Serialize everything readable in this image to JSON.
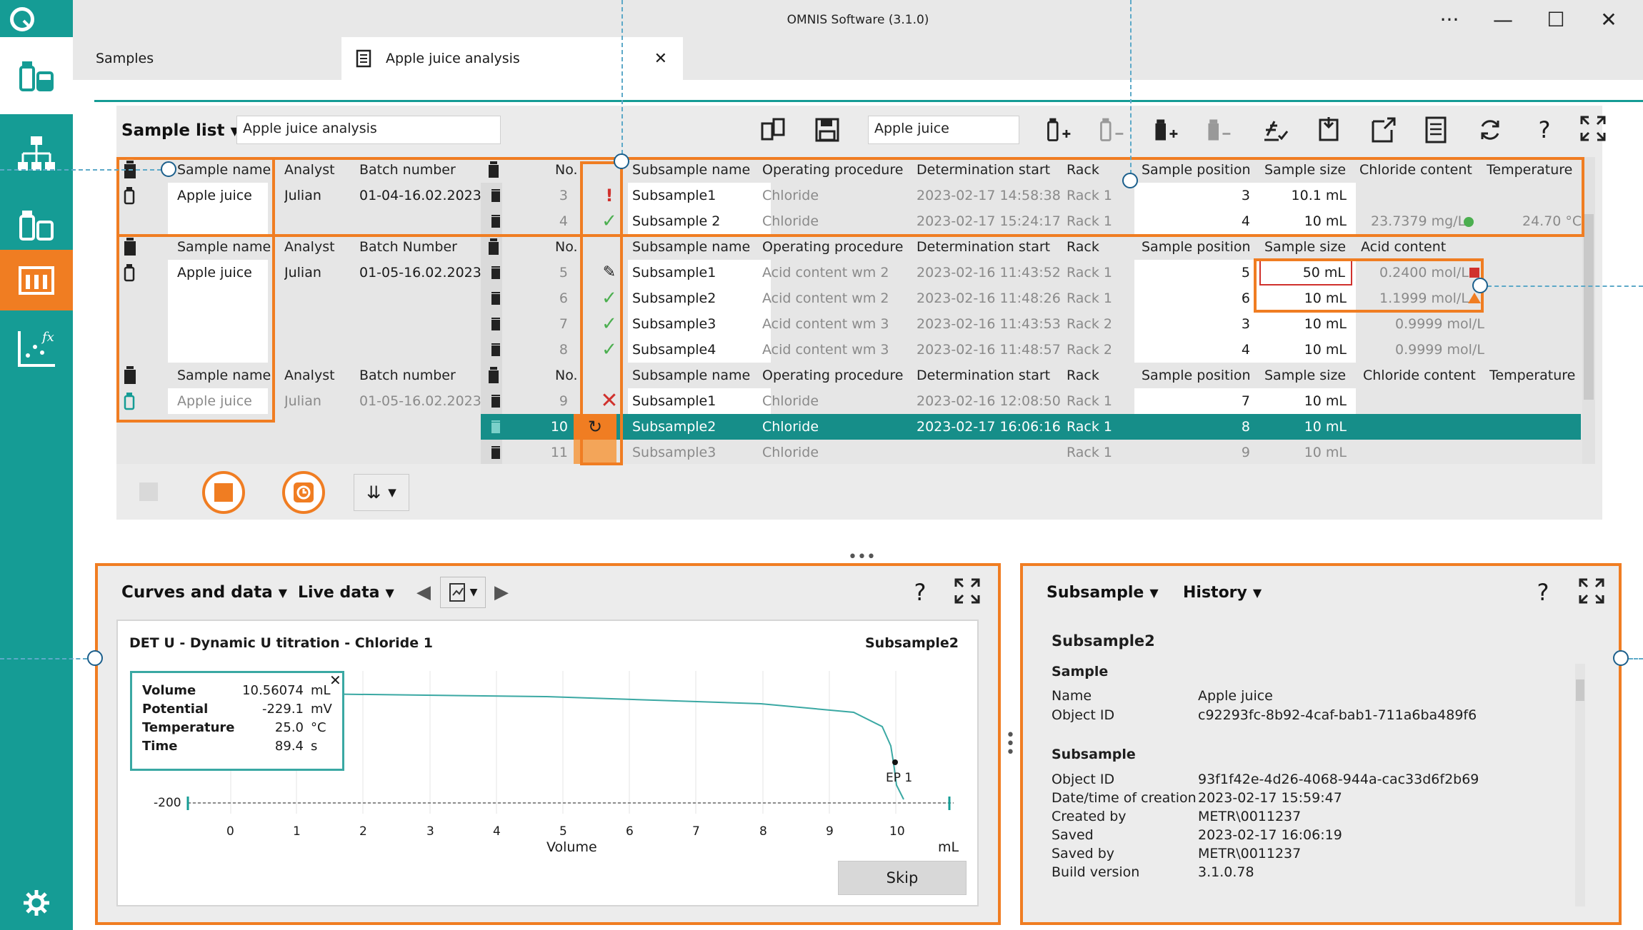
{
  "window": {
    "title": "OMNIS Software (3.1.0)"
  },
  "tabs": [
    {
      "label": "Samples"
    },
    {
      "label": "Apple juice analysis"
    }
  ],
  "sample_list": {
    "menu_label": "Sample list",
    "name_value": "Apple juice analysis",
    "filter_value": "Apple juice",
    "columns": [
      "Sample name",
      "Analyst",
      "Batch number",
      "No.",
      "Subsample name",
      "Operating procedure",
      "Determination start",
      "Rack",
      "Sample position",
      "Sample size",
      "Chloride content",
      "Temperature"
    ],
    "group2_columns": [
      "Sample name",
      "Analyst",
      "Batch Number",
      "No.",
      "Subsample name",
      "Operating procedure",
      "Determination start",
      "Rack",
      "Sample position",
      "Sample size",
      "Acid content"
    ],
    "group3_columns": [
      "Sample name",
      "Analyst",
      "Batch number",
      "No.",
      "Subsample name",
      "Operating procedure",
      "Determination start",
      "Rack",
      "Sample position",
      "Sample size",
      "Chloride content",
      "Temperature"
    ],
    "group1": {
      "sample_name": "Apple juice",
      "analyst": "Julian",
      "batch": "01-04-16.02.2023",
      "rows": [
        {
          "no": "3",
          "subsample": "Subsample1",
          "procedure": "Chloride",
          "start": "2023-02-17 14:58:38",
          "rack": "Rack 1",
          "position": "3",
          "size": "10.1 mL",
          "result": "",
          "temp": ""
        },
        {
          "no": "4",
          "subsample": "Subsample 2",
          "procedure": "Chloride",
          "start": "2023-02-17 15:24:17",
          "rack": "Rack 1",
          "position": "4",
          "size": "10 mL",
          "result": "23.7379 mg/L",
          "temp": "24.70 °C"
        }
      ]
    },
    "group2": {
      "sample_name": "Apple juice",
      "analyst": "Julian",
      "batch": "01-05-16.02.2023",
      "rows": [
        {
          "no": "5",
          "subsample": "Subsample1",
          "procedure": "Acid content wm 2",
          "start": "2023-02-16 11:43:52",
          "rack": "Rack 1",
          "position": "5",
          "size": "50 mL",
          "result": "0.2400 mol/L"
        },
        {
          "no": "6",
          "subsample": "Subsample2",
          "procedure": "Acid content wm 2",
          "start": "2023-02-16 11:48:26",
          "rack": "Rack 1",
          "position": "6",
          "size": "10 mL",
          "result": "1.1999 mol/L"
        },
        {
          "no": "7",
          "subsample": "Subsample3",
          "procedure": "Acid content wm 3",
          "start": "2023-02-16 11:43:53",
          "rack": "Rack 2",
          "position": "3",
          "size": "10 mL",
          "result": "0.9999 mol/L"
        },
        {
          "no": "8",
          "subsample": "Subsample4",
          "procedure": "Acid content wm 3",
          "start": "2023-02-16 11:48:57",
          "rack": "Rack 2",
          "position": "4",
          "size": "10 mL",
          "result": "0.9999 mol/L"
        }
      ]
    },
    "group3": {
      "sample_name": "Apple juice",
      "analyst": "Julian",
      "batch": "01-05-16.02.2023",
      "rows": [
        {
          "no": "9",
          "subsample": "Subsample1",
          "procedure": "Chloride",
          "start": "2023-02-16 12:08:50",
          "rack": "Rack 1",
          "position": "7",
          "size": "10 mL"
        },
        {
          "no": "10",
          "subsample": "Subsample2",
          "procedure": "Chloride",
          "start": "2023-02-17 16:06:16",
          "rack": "Rack 1",
          "position": "8",
          "size": "10 mL"
        },
        {
          "no": "11",
          "subsample": "Subsample3",
          "procedure": "Chloride",
          "start": "",
          "rack": "Rack 1",
          "position": "9",
          "size": "10 mL"
        }
      ]
    }
  },
  "curves": {
    "menu_label": "Curves and data",
    "live_label": "Live data",
    "plot_title": "DET U - Dynamic U titration - Chloride  1",
    "plot_subsample": "Subsample2",
    "tooltip": [
      {
        "label": "Volume",
        "value": "10.56074",
        "unit": "mL"
      },
      {
        "label": "Potential",
        "value": "-229.1",
        "unit": "mV"
      },
      {
        "label": "Temperature",
        "value": "25.0",
        "unit": "°C"
      },
      {
        "label": "Time",
        "value": "89.4",
        "unit": "s"
      }
    ],
    "y_tick": "-200",
    "x_ticks": [
      "0",
      "1",
      "2",
      "3",
      "4",
      "5",
      "6",
      "7",
      "8",
      "9",
      "10"
    ],
    "x_label": "Volume",
    "x_unit": "mL",
    "ep_label": "EP 1",
    "skip_label": "Skip"
  },
  "detail": {
    "menu_label": "Subsample",
    "history_label": "History",
    "title": "Subsample2",
    "sample_section": "Sample",
    "sample_fields": [
      {
        "label": "Name",
        "value": "Apple juice"
      },
      {
        "label": "Object ID",
        "value": "c92293fc-8b92-4caf-bab1-711a6ba489f6"
      }
    ],
    "subsample_section": "Subsample",
    "subsample_fields": [
      {
        "label": "Object ID",
        "value": "93f1f42e-4d26-4068-944a-cac33d6f2b69"
      },
      {
        "label": "Date/time of creation",
        "value": "2023-02-17 15:59:47"
      },
      {
        "label": "Created by",
        "value": "METR\\0011237"
      },
      {
        "label": "Saved",
        "value": "2023-02-17 16:06:19"
      },
      {
        "label": "Saved by",
        "value": "METR\\0011237"
      },
      {
        "label": "Build version",
        "value": "3.1.0.78"
      }
    ]
  },
  "colors": {
    "teal": "#159c95",
    "orange": "#f07d22",
    "selected_row": "#168e89",
    "status_ok": "#4caf50",
    "status_error": "#d0312d",
    "status_warning": "#f07d22"
  }
}
